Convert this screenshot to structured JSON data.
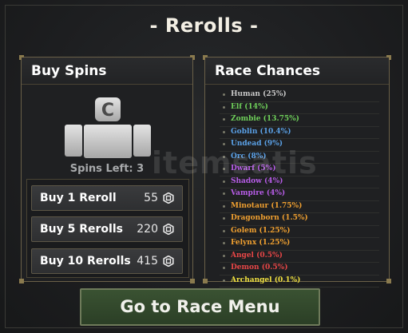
{
  "window": {
    "title": "- Rerolls -"
  },
  "buy_panel": {
    "header": "Buy Spins",
    "avatar_icon": "roblox-avatar-icon",
    "spins_left": "Spins Left: 3",
    "buttons": [
      {
        "label": "Buy 1 Reroll",
        "price": "55"
      },
      {
        "label": "Buy 5 Rerolls",
        "price": "220"
      },
      {
        "label": "Buy 10 Rerolls",
        "price": "415"
      }
    ],
    "currency_icon": "robux-icon"
  },
  "race_panel": {
    "header": "Race Chances",
    "races": [
      {
        "text": "Human (25%)",
        "color": "#c8c8c8"
      },
      {
        "text": "Elf (14%)",
        "color": "#6fcf5a"
      },
      {
        "text": "Zombie (13.75%)",
        "color": "#6fcf5a"
      },
      {
        "text": "Goblin (10.4%)",
        "color": "#5aa0e6"
      },
      {
        "text": "Undead (9%)",
        "color": "#5aa0e6"
      },
      {
        "text": "Orc (8%)",
        "color": "#5aa0e6"
      },
      {
        "text": "Dwarf (5%)",
        "color": "#b65ce6"
      },
      {
        "text": "Shadow (4%)",
        "color": "#b65ce6"
      },
      {
        "text": "Vampire (4%)",
        "color": "#b65ce6"
      },
      {
        "text": "Minotaur (1.75%)",
        "color": "#f0a030"
      },
      {
        "text": "Dragonborn (1.5%)",
        "color": "#f0a030"
      },
      {
        "text": "Golem (1.25%)",
        "color": "#f0a030"
      },
      {
        "text": "Felynx (1.25%)",
        "color": "#f0a030"
      },
      {
        "text": "Angel (0.5%)",
        "color": "#e64646"
      },
      {
        "text": "Demon (0.5%)",
        "color": "#e64646"
      },
      {
        "text": "Archangel (0.1%)",
        "color": "#f0e040"
      }
    ]
  },
  "footer": {
    "race_menu_label": "Go to Race Menu"
  },
  "watermark": "itemsatis"
}
